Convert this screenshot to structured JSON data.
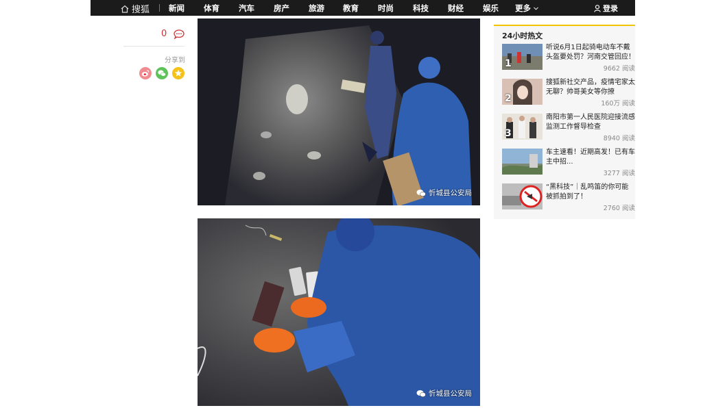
{
  "header": {
    "brand": "搜狐",
    "nav": [
      "新闻",
      "体育",
      "汽车",
      "房产",
      "旅游",
      "教育",
      "时尚",
      "科技",
      "财经",
      "娱乐",
      "更多"
    ],
    "login": "登录"
  },
  "article": {
    "comment_count": "0",
    "share_label": "分享到",
    "share_targets": [
      "weibo",
      "wechat",
      "qzone"
    ],
    "images": [
      {
        "watermark": "忻城县公安局"
      },
      {
        "watermark": "忻城县公安局"
      }
    ]
  },
  "sidebar": {
    "title": "24小时热文",
    "items": [
      {
        "rank": "1",
        "title": "听说6月1日起骑电动车不戴头盔要处罚？河南交管回应！",
        "reads": "9662 阅读"
      },
      {
        "rank": "2",
        "title": "搜狐新社交产品，疫情宅家太无聊？帅哥美女等你撩",
        "reads": "160万 阅读"
      },
      {
        "rank": "3",
        "title": "南阳市第一人民医院迎接流感监测工作督导检查",
        "reads": "8940 阅读"
      },
      {
        "rank": "",
        "title": "车主速看！近期高发！已有车主中招...",
        "reads": "3277 阅读"
      },
      {
        "rank": "",
        "title": "“黑科技”｜乱鸣笛的你可能被抓拍到了！",
        "reads": "2760 阅读"
      }
    ]
  },
  "colors": {
    "topbar": "#1b1b1b",
    "accent": "#f2c300",
    "comment_red": "#cc3333",
    "weibo": "#e6162d",
    "wechat": "#3cb034",
    "qzone": "#f5b800"
  }
}
